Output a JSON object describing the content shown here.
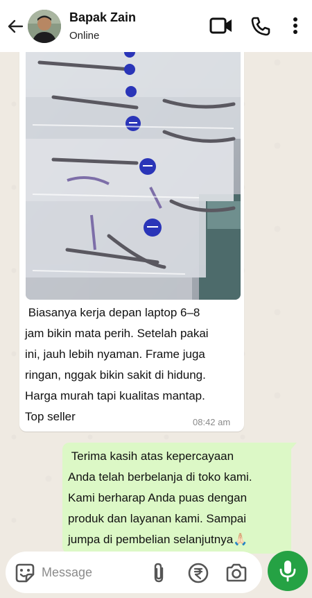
{
  "header": {
    "contact_name": "Bapak Zain",
    "status": "Online",
    "icons": [
      "back-arrow-icon",
      "video-call-icon",
      "voice-call-icon",
      "more-vert-icon"
    ]
  },
  "messages": [
    {
      "direction": "incoming",
      "has_image": true,
      "image_subject": "reading-glasses-in-plastic-bags",
      "text": " Biasanya kerja depan laptop 6–8\njam bikin mata perih. Setelah pakai\nini, jauh lebih nyaman. Frame juga\nringan, nggak bikin sakit di hidung.\nHarga murah tapi kualitas mantap.\nTop seller",
      "time": "08:42 am"
    },
    {
      "direction": "outgoing",
      "text": " Terima kasih atas kepercayaan\nAnda telah berbelanja di toko kami.\nKami berharap Anda puas dengan\nproduk dan layanan kami. Sampai\njumpa di pembelian selanjutnya🙏🏻"
    }
  ],
  "composer": {
    "placeholder": "Message",
    "icons": [
      "sticker-icon",
      "attach-icon",
      "rupee-payment-icon",
      "camera-icon",
      "mic-icon"
    ]
  },
  "colors": {
    "accent_green": "#25a244",
    "outgoing_bubble": "#dcf8c6",
    "incoming_bubble": "#ffffff",
    "chat_background": "#efeae2"
  }
}
